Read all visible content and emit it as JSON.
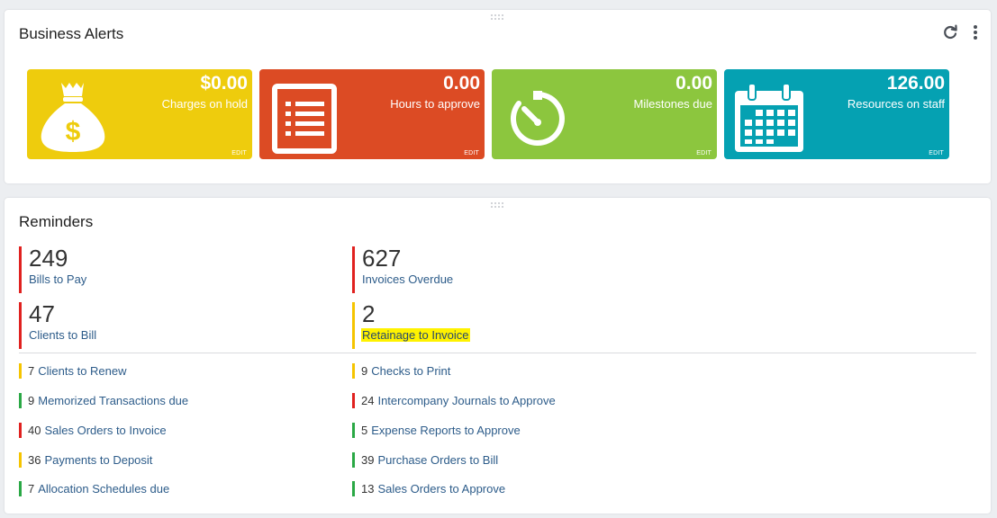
{
  "alerts": {
    "title": "Business Alerts",
    "tiles": [
      {
        "value": "$0.00",
        "label": "Charges on hold",
        "edit": "EDIT",
        "color": "#eecc0d",
        "icon": "money-bag-icon"
      },
      {
        "value": "0.00",
        "label": "Hours to approve",
        "edit": "EDIT",
        "color": "#dc4b24",
        "icon": "list-icon"
      },
      {
        "value": "0.00",
        "label": "Milestones due",
        "edit": "EDIT",
        "color": "#8cc63e",
        "icon": "stopwatch-icon"
      },
      {
        "value": "126.00",
        "label": "Resources on staff",
        "edit": "EDIT",
        "color": "#05a1b2",
        "icon": "calendar-icon"
      }
    ]
  },
  "reminders": {
    "title": "Reminders",
    "big": [
      {
        "value": "249",
        "label": "Bills to Pay",
        "status": "red"
      },
      {
        "value": "627",
        "label": "Invoices Overdue",
        "status": "red"
      },
      {
        "value": "47",
        "label": "Clients to Bill",
        "status": "red"
      },
      {
        "value": "2",
        "label": "Retainage to Invoice",
        "status": "yellow"
      }
    ],
    "left": [
      {
        "value": "7",
        "label": "Clients to Renew",
        "status": "yellow"
      },
      {
        "value": "9",
        "label": "Memorized Transactions due",
        "status": "green"
      },
      {
        "value": "40",
        "label": "Sales Orders to Invoice",
        "status": "red"
      },
      {
        "value": "36",
        "label": "Payments to Deposit",
        "status": "yellow"
      },
      {
        "value": "7",
        "label": "Allocation Schedules due",
        "status": "green"
      }
    ],
    "right": [
      {
        "value": "9",
        "label": "Checks to Print",
        "status": "yellow"
      },
      {
        "value": "24",
        "label": "Intercompany Journals to Approve",
        "status": "red"
      },
      {
        "value": "5",
        "label": "Expense Reports to Approve",
        "status": "green"
      },
      {
        "value": "39",
        "label": "Purchase Orders to Bill",
        "status": "green"
      },
      {
        "value": "13",
        "label": "Sales Orders to Approve",
        "status": "green"
      }
    ]
  },
  "colors": {
    "red": "#e0211f",
    "yellow": "#f5c400",
    "green": "#2aa845",
    "highlight": "#fff200"
  }
}
